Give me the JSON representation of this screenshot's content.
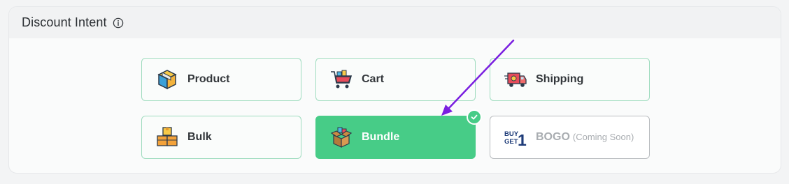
{
  "panel": {
    "title": "Discount Intent",
    "info_icon": "info-icon"
  },
  "options": [
    {
      "key": "product",
      "label": "Product",
      "icon": "product-box-icon",
      "selected": false
    },
    {
      "key": "cart",
      "label": "Cart",
      "icon": "shopping-cart-icon",
      "selected": false
    },
    {
      "key": "shipping",
      "label": "Shipping",
      "icon": "delivery-truck-icon",
      "selected": false
    },
    {
      "key": "bulk",
      "label": "Bulk",
      "icon": "stacked-boxes-icon",
      "selected": false
    },
    {
      "key": "bundle",
      "label": "Bundle",
      "icon": "open-box-icon",
      "selected": true
    },
    {
      "key": "bogo",
      "label": "BOGO",
      "suffix": "(Coming Soon)",
      "icon": "buy-get-1-icon",
      "selected": false,
      "disabled": true
    }
  ],
  "bogo_icon_text": {
    "line1": "BUY",
    "line2": "GET",
    "number": "1"
  },
  "colors": {
    "accent": "#47cc87",
    "card_border": "#9fdcbf",
    "annotation_arrow": "#7a1fe0"
  }
}
